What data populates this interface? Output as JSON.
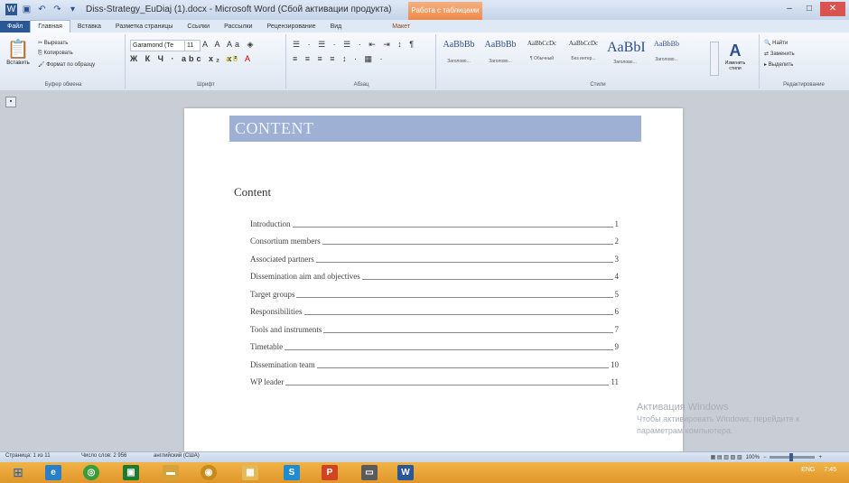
{
  "window": {
    "title": "Diss-Strategy_EuDiaj (1).docx - Microsoft Word (Сбой активации продукта)",
    "context_tab": "Работа с таблицами",
    "minimize": "–",
    "maximize": "□",
    "close": "✕"
  },
  "ribbon": {
    "tabs": [
      {
        "label": "Файл"
      },
      {
        "label": "Главная"
      },
      {
        "label": "Вставка"
      },
      {
        "label": "Разметка страницы"
      },
      {
        "label": "Ссылки"
      },
      {
        "label": "Рассылки"
      },
      {
        "label": "Рецензирование"
      },
      {
        "label": "Вид"
      },
      {
        "label": "Макет"
      }
    ],
    "clipboard": {
      "paste": "Вставить",
      "cut": "Вырезать",
      "copy": "Копировать",
      "format_painter": "Формат по образцу",
      "label": "Буфер обмена"
    },
    "font": {
      "name": "Garamond (Те",
      "size": "11",
      "row2": "Ж К Ч · abc x₂ x²",
      "label": "Шрифт"
    },
    "paragraph": {
      "row1": "☰ · ☰ · ☰ · ⇤ ⇥ ↕ ¶",
      "row2": "≡ ≡ ≡ ≡ ↕ · ▦ ·",
      "label": "Абзац"
    },
    "styles": {
      "items": [
        {
          "sample": "AaBbBb",
          "name": "Заголово..."
        },
        {
          "sample": "AaBbBb",
          "name": "Заголово..."
        },
        {
          "sample": "AaBbCcDc",
          "name": "¶ Обычный"
        },
        {
          "sample": "AaBbCcDc",
          "name": "Без интер..."
        },
        {
          "sample": "AaBbI",
          "name": "Заголово..."
        },
        {
          "sample": "AaBbBb",
          "name": "Заголово..."
        }
      ],
      "change": "Изменить стили",
      "label": "Стили"
    },
    "editing": {
      "find": "Найти",
      "replace": "Заменить",
      "select": "Выделить",
      "label": "Редактирование"
    }
  },
  "document": {
    "heading": "CONTENT",
    "toc_title": "Content",
    "toc": [
      {
        "label": "Introduction",
        "page": "1"
      },
      {
        "label": "Consortium members",
        "page": "2"
      },
      {
        "label": "Associated partners",
        "page": "3"
      },
      {
        "label": "Dissemination aim and objectives",
        "page": "4"
      },
      {
        "label": "Target groups",
        "page": "5"
      },
      {
        "label": "Responsibilities",
        "page": "6"
      },
      {
        "label": "Tools and instruments",
        "page": "7"
      },
      {
        "label": "Timetable",
        "page": "9"
      },
      {
        "label": "Dissemination team",
        "page": "10"
      },
      {
        "label": "WP leader",
        "page": "11"
      }
    ]
  },
  "watermark": {
    "line1": "Активация Windows",
    "line2": "Чтобы активировать Windows, перейдите к",
    "line3": "параметрам компьютера."
  },
  "status": {
    "page": "Страница: 1 из 11",
    "words": "Число слов: 2 956",
    "language": "английский (США)",
    "zoom": "100%"
  },
  "taskbar": {
    "tray_lang": "ENG",
    "time": "7:45"
  }
}
